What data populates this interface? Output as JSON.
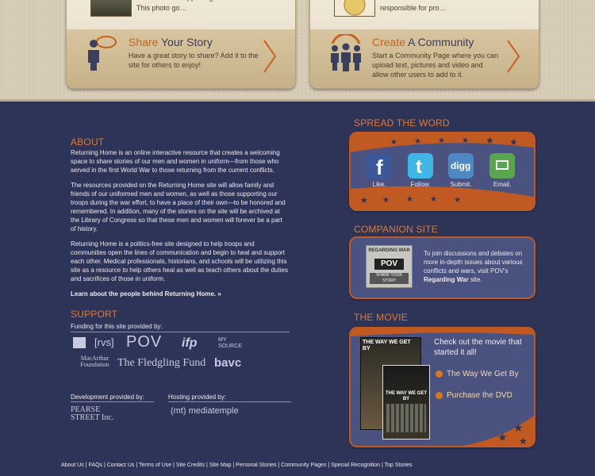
{
  "top_cards": {
    "left": {
      "snippet": "of Americans supporting us and our service. This photo go…",
      "title_accent": "Share",
      "title_rest": " Your Story",
      "description": "Have a great story to share? Add it to the site for others to enjoy!"
    },
    "right": {
      "snippet": "a branch of the United States Armed Forces responsible for pro…",
      "title_accent": "Create",
      "title_rest": " A Community",
      "description": "Start a Community Page where you can upload text, pictures and video and allow other users to add to it."
    }
  },
  "about": {
    "heading": "ABOUT",
    "paragraphs": [
      "Returning Home is an online interactive resource that creates a welcoming space to share stories of our men and women in uniform—from those who served in the first World War to those returning from the current conflicts.",
      "The resources provided on the Returning Home site will allow family and friends of our uniformed men and women, as well as those supporting our troops during the war effort, to have a place of their own—to be honored and remembered. In addition, many of the stories on the site will be archived at the Library of Congress so that these men and women will forever be a part of history.",
      "Returning Home is a politics-free site designed to help troops and communities open the lines of communication and begin to heal and support each other. Medical professionals, historians, and schools will be utilizing this site as a resource to help others heal as well as teach others about the duties and sacrifices of those in uniform."
    ],
    "link": "Learn about the people behind Returning Home. »"
  },
  "support": {
    "heading": "SUPPORT",
    "funding_label": "Funding for this site provided by:",
    "logos": [
      "[rvs]",
      "POV",
      "ifp",
      "MY SOURCE",
      "MacArthur Foundation",
      "The Fledgling Fund",
      "bavc"
    ],
    "development_label": "Development provided by:",
    "development_logo": "PEARSE STREET Inc.",
    "hosting_label": "Hosting provided by:",
    "hosting_logo": "(mt) mediatemple"
  },
  "spread": {
    "heading": "SPREAD THE WORD",
    "items": [
      {
        "label": "Like.",
        "icon": "facebook-icon",
        "color": "#3b5998"
      },
      {
        "label": "Follow.",
        "icon": "twitter-icon",
        "color": "#3fb7e6"
      },
      {
        "label": "Submit.",
        "icon": "digg-icon",
        "color": "#4d88c4"
      },
      {
        "label": "Email.",
        "icon": "email-icon",
        "color": "#5aa64e"
      }
    ]
  },
  "companion": {
    "heading": "COMPANION SITE",
    "logo_top": "REGARDING WAR",
    "logo_pov": "POV",
    "logo_bottom": "SHARE YOUR STORY",
    "text_prefix": "To join discussions and debates on more in-depth issues about various conflicts and wars, visit POV's ",
    "text_bold": "Regarding War",
    "text_suffix": " site."
  },
  "movie": {
    "heading": "THE MOVIE",
    "intro": "Check out the movie that started it all!",
    "poster_title": "THE WAY WE GET BY",
    "links": [
      "The Way We Get By",
      "Purchase the DVD"
    ]
  },
  "footer": [
    "About Us",
    "FAQs",
    "Contact Us",
    "Terms of Use",
    "Site Credits",
    "Site Map",
    "Personal Stories",
    "Community Pages",
    "Special Recognition",
    "Top Stories"
  ],
  "colors": {
    "accent": "#de7a35",
    "panel": "#2e3458",
    "box": "#4a5280"
  }
}
